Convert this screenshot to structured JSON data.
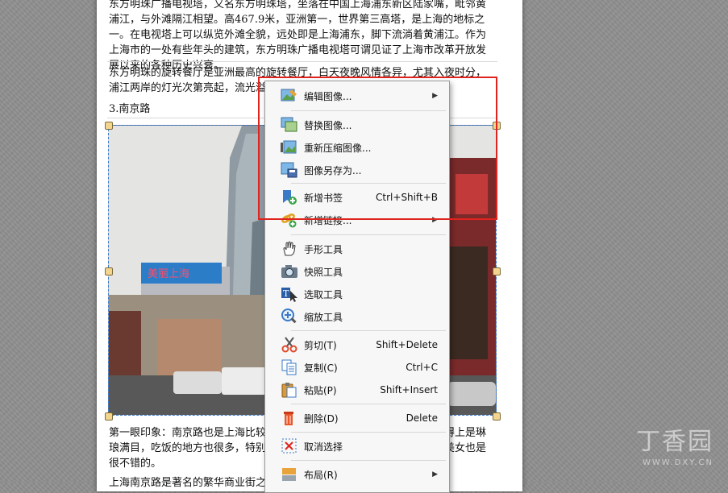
{
  "document": {
    "para1": "东方明珠广播电视塔，又名东方明珠塔，坐落在中国上海浦东新区陆家嘴，毗邻黄浦江，与外滩隔江相望。高467.9米，亚洲第一，世界第三高塔，是上海的地标之一。在电视塔上可以纵览外滩全貌，远处即是上海浦东，脚下流淌着黄浦江。作为上海市的一处有些年头的建筑，东方明珠广播电视塔可谓见证了上海市改革开放发展以来的各种历史兴衰。",
    "para2": "东方明珠的旋转餐厅是亚洲最高的旋转餐厅，白天夜晚风情各异，尤其入夜时分，浦江两岸的灯光次第亮起，流光溢彩",
    "heading": "3.南京路",
    "para3": "第一眼印象：南京路也是上海比较有名的商业街，街道两旁商店林立，算得上是琳琅满目，吃饭的地方也很多，特别是周末的时候，人流如织，去看看帅哥美女也是很不错的。",
    "para4": "上海南京路是著名的繁华商业街之一"
  },
  "photo": {
    "sign_text": "美丽上海"
  },
  "watermark": {
    "main": "丁香园",
    "url": "WWW.DXY.CN"
  },
  "menu": {
    "items": [
      {
        "label": "编辑图像...",
        "shortcut": "",
        "submenu": true,
        "icon": "edit-image-icon"
      },
      {
        "label": "替换图像...",
        "shortcut": "",
        "submenu": false,
        "icon": "replace-image-icon"
      },
      {
        "label": "重新压缩图像...",
        "shortcut": "",
        "submenu": false,
        "icon": "recompress-image-icon"
      },
      {
        "label": "图像另存为...",
        "shortcut": "",
        "submenu": false,
        "icon": "save-image-icon"
      },
      {
        "label": "新增书签",
        "shortcut": "Ctrl+Shift+B",
        "submenu": false,
        "icon": "bookmark-add-icon"
      },
      {
        "label": "新增链接...",
        "shortcut": "",
        "submenu": true,
        "icon": "link-add-icon"
      },
      {
        "label": "手形工具",
        "shortcut": "",
        "submenu": false,
        "icon": "hand-icon"
      },
      {
        "label": "快照工具",
        "shortcut": "",
        "submenu": false,
        "icon": "camera-icon"
      },
      {
        "label": "选取工具",
        "shortcut": "",
        "submenu": false,
        "icon": "select-text-icon"
      },
      {
        "label": "缩放工具",
        "shortcut": "",
        "submenu": false,
        "icon": "zoom-icon"
      },
      {
        "label": "剪切(T)",
        "shortcut": "Shift+Delete",
        "submenu": false,
        "icon": "scissors-icon"
      },
      {
        "label": "复制(C)",
        "shortcut": "Ctrl+C",
        "submenu": false,
        "icon": "copy-icon"
      },
      {
        "label": "粘贴(P)",
        "shortcut": "Shift+Insert",
        "submenu": false,
        "icon": "paste-icon"
      },
      {
        "label": "删除(D)",
        "shortcut": "Delete",
        "submenu": false,
        "icon": "trash-icon"
      },
      {
        "label": "取消选择",
        "shortcut": "",
        "submenu": false,
        "icon": "deselect-icon"
      },
      {
        "label": "布局(R)",
        "shortcut": "",
        "submenu": true,
        "icon": "layout-icon"
      }
    ]
  },
  "colors": {
    "highlight": "#e0231e",
    "selection": "#3a7bd5"
  }
}
